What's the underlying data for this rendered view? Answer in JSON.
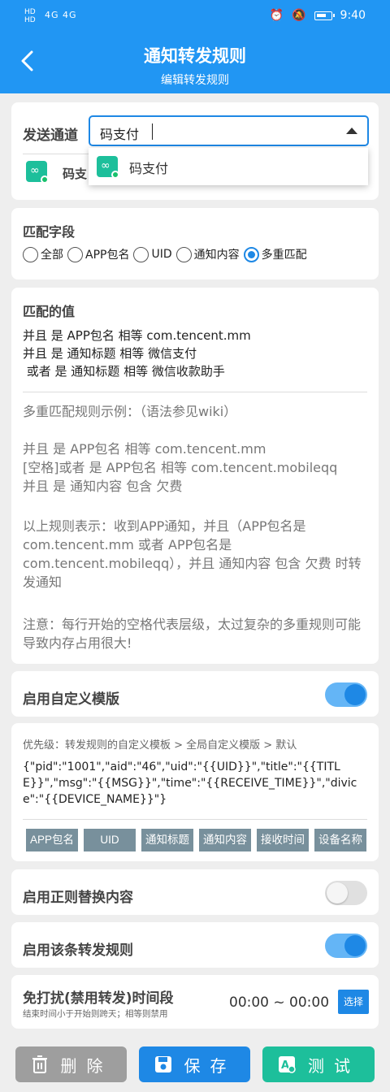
{
  "status": {
    "time": "9:40",
    "sim_hd": "HD",
    "signal_text": "4G 4G"
  },
  "header": {
    "title": "通知转发规则",
    "subtitle": "编辑转发规则"
  },
  "channel": {
    "label": "发送通道",
    "input_value": "码支付",
    "list_item": "码支",
    "dropdown_option": "码支付"
  },
  "match_field": {
    "label": "匹配字段",
    "options": [
      "全部",
      "APP包名",
      "UID",
      "通知内容",
      "多重匹配"
    ],
    "selected": "多重匹配"
  },
  "match_value": {
    "label": "匹配的值",
    "lines": "并且 是 APP包名 相等 com.tencent.mm\n并且 是 通知标题 相等 微信支付\n 或者 是 通知标题 相等 微信收款助手",
    "example_title": "多重匹配规则示例：（语法参见wiki）",
    "example_1": "并且 是 APP包名 相等 com.tencent.mm",
    "example_2": "[空格]或者 是 APP包名 相等 com.tencent.mobileqq",
    "example_3": "并且 是 通知内容 包含 欠费",
    "explain": "以上规则表示：收到APP通知，并且（APP包名是com.tencent.mm 或者 APP包名是com.tencent.mobileqq），并且 通知内容 包含 欠费 时转发通知",
    "note": "注意：每行开始的空格代表层级，太过复杂的多重规则可能导致内存占用很大!"
  },
  "custom_template": {
    "label": "启用自定义模版",
    "enabled": true,
    "priority": "优先级：转发规则的自定义模板 > 全局自定义模版 > 默认",
    "text": "{\"pid\":\"1001\",\"aid\":\"46\",\"uid\":\"{{UID}}\",\"title\":\"{{TITLE}}\",\"msg\":\"{{MSG}}\",\"time\":\"{{RECEIVE_TIME}}\",\"divice\":\"{{DEVICE_NAME}}\"}",
    "vars": [
      "APP包名",
      "UID",
      "通知标题",
      "通知内容",
      "接收时间",
      "设备名称"
    ]
  },
  "regex": {
    "label": "启用正则替换内容",
    "enabled": false
  },
  "enable_rule": {
    "label": "启用该条转发规则",
    "enabled": true
  },
  "dnd": {
    "label": "免打扰(禁用转发)时间段",
    "sub": "结束时间小于开始则跨天；相等则禁用",
    "time": "00:00 ~ 00:00",
    "select_label": "选择"
  },
  "actions": {
    "delete": "删除",
    "save": "保存",
    "test": "测试"
  },
  "colors": {
    "primary": "#2196f3",
    "accent": "#1e88e5",
    "green": "#1dbf9b",
    "gray": "#9e9e9e",
    "chip": "#78909c"
  }
}
